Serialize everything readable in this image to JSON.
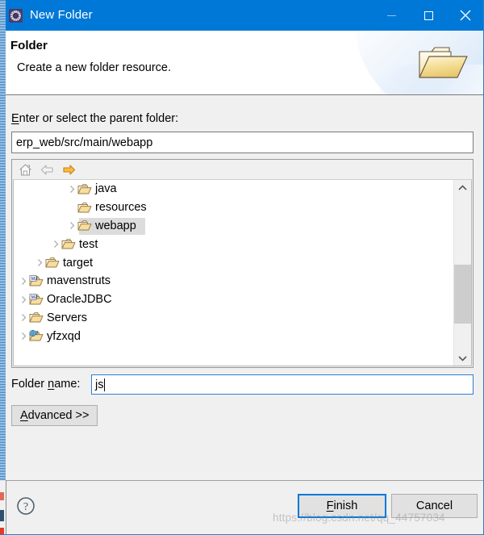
{
  "window": {
    "title": "New Folder",
    "app_icon": "eclipse-gear-icon",
    "titlebar_color": "#0078d7",
    "controls": {
      "minimize": "minimize-icon",
      "maximize": "maximize-icon",
      "close": "close-icon"
    }
  },
  "banner": {
    "title": "Folder",
    "subtitle": "Create a new folder resource.",
    "icon": "folder-large-icon"
  },
  "form": {
    "parent_label_pre": "E",
    "parent_label_post": "nter or select the parent folder:",
    "parent_path_value": "erp_web/src/main/webapp",
    "folder_name_label_pre": "Folder ",
    "folder_name_label_accel": "n",
    "folder_name_label_post": "ame:",
    "folder_name_value": "js",
    "advanced_label_pre": "A",
    "advanced_label_post": "dvanced >>"
  },
  "tree": {
    "toolbar": [
      {
        "name": "home-icon",
        "enabled": true
      },
      {
        "name": "back-arrow-icon",
        "enabled": false
      },
      {
        "name": "forward-arrow-icon",
        "enabled": true
      }
    ],
    "rows": [
      {
        "label": "java",
        "indent": 3,
        "icon": "folder-open-icon",
        "twisty": "collapsed",
        "selected": false
      },
      {
        "label": "resources",
        "indent": 3,
        "icon": "folder-open-icon",
        "twisty": "none",
        "selected": false
      },
      {
        "label": "webapp",
        "indent": 3,
        "icon": "folder-open-icon",
        "twisty": "collapsed",
        "selected": true
      },
      {
        "label": "test",
        "indent": 2,
        "icon": "folder-open-icon",
        "twisty": "collapsed",
        "selected": false
      },
      {
        "label": "target",
        "indent": 1,
        "icon": "folder-open-icon",
        "twisty": "collapsed",
        "selected": false
      },
      {
        "label": "mavenstruts",
        "indent": 0,
        "icon": "maven-project-icon",
        "twisty": "collapsed",
        "selected": false
      },
      {
        "label": "OracleJDBC",
        "indent": 0,
        "icon": "maven-project-icon",
        "twisty": "collapsed",
        "selected": false
      },
      {
        "label": "Servers",
        "indent": 0,
        "icon": "folder-open-icon",
        "twisty": "collapsed",
        "selected": false
      },
      {
        "label": "yfzxqd",
        "indent": 0,
        "icon": "web-project-icon",
        "twisty": "collapsed",
        "selected": false
      }
    ],
    "scrollbar": {
      "up_arrow": "chevron-up-icon",
      "down_arrow": "chevron-down-icon",
      "thumb_top_pct": 45,
      "thumb_height_pct": 38
    }
  },
  "footer": {
    "help": "help-icon",
    "finish_label_pre": "F",
    "finish_label_post": "inish",
    "cancel_label": "Cancel",
    "default_button": "Finish"
  },
  "watermark": {
    "text": "https://blog.csdn.net/qq_44757034"
  }
}
